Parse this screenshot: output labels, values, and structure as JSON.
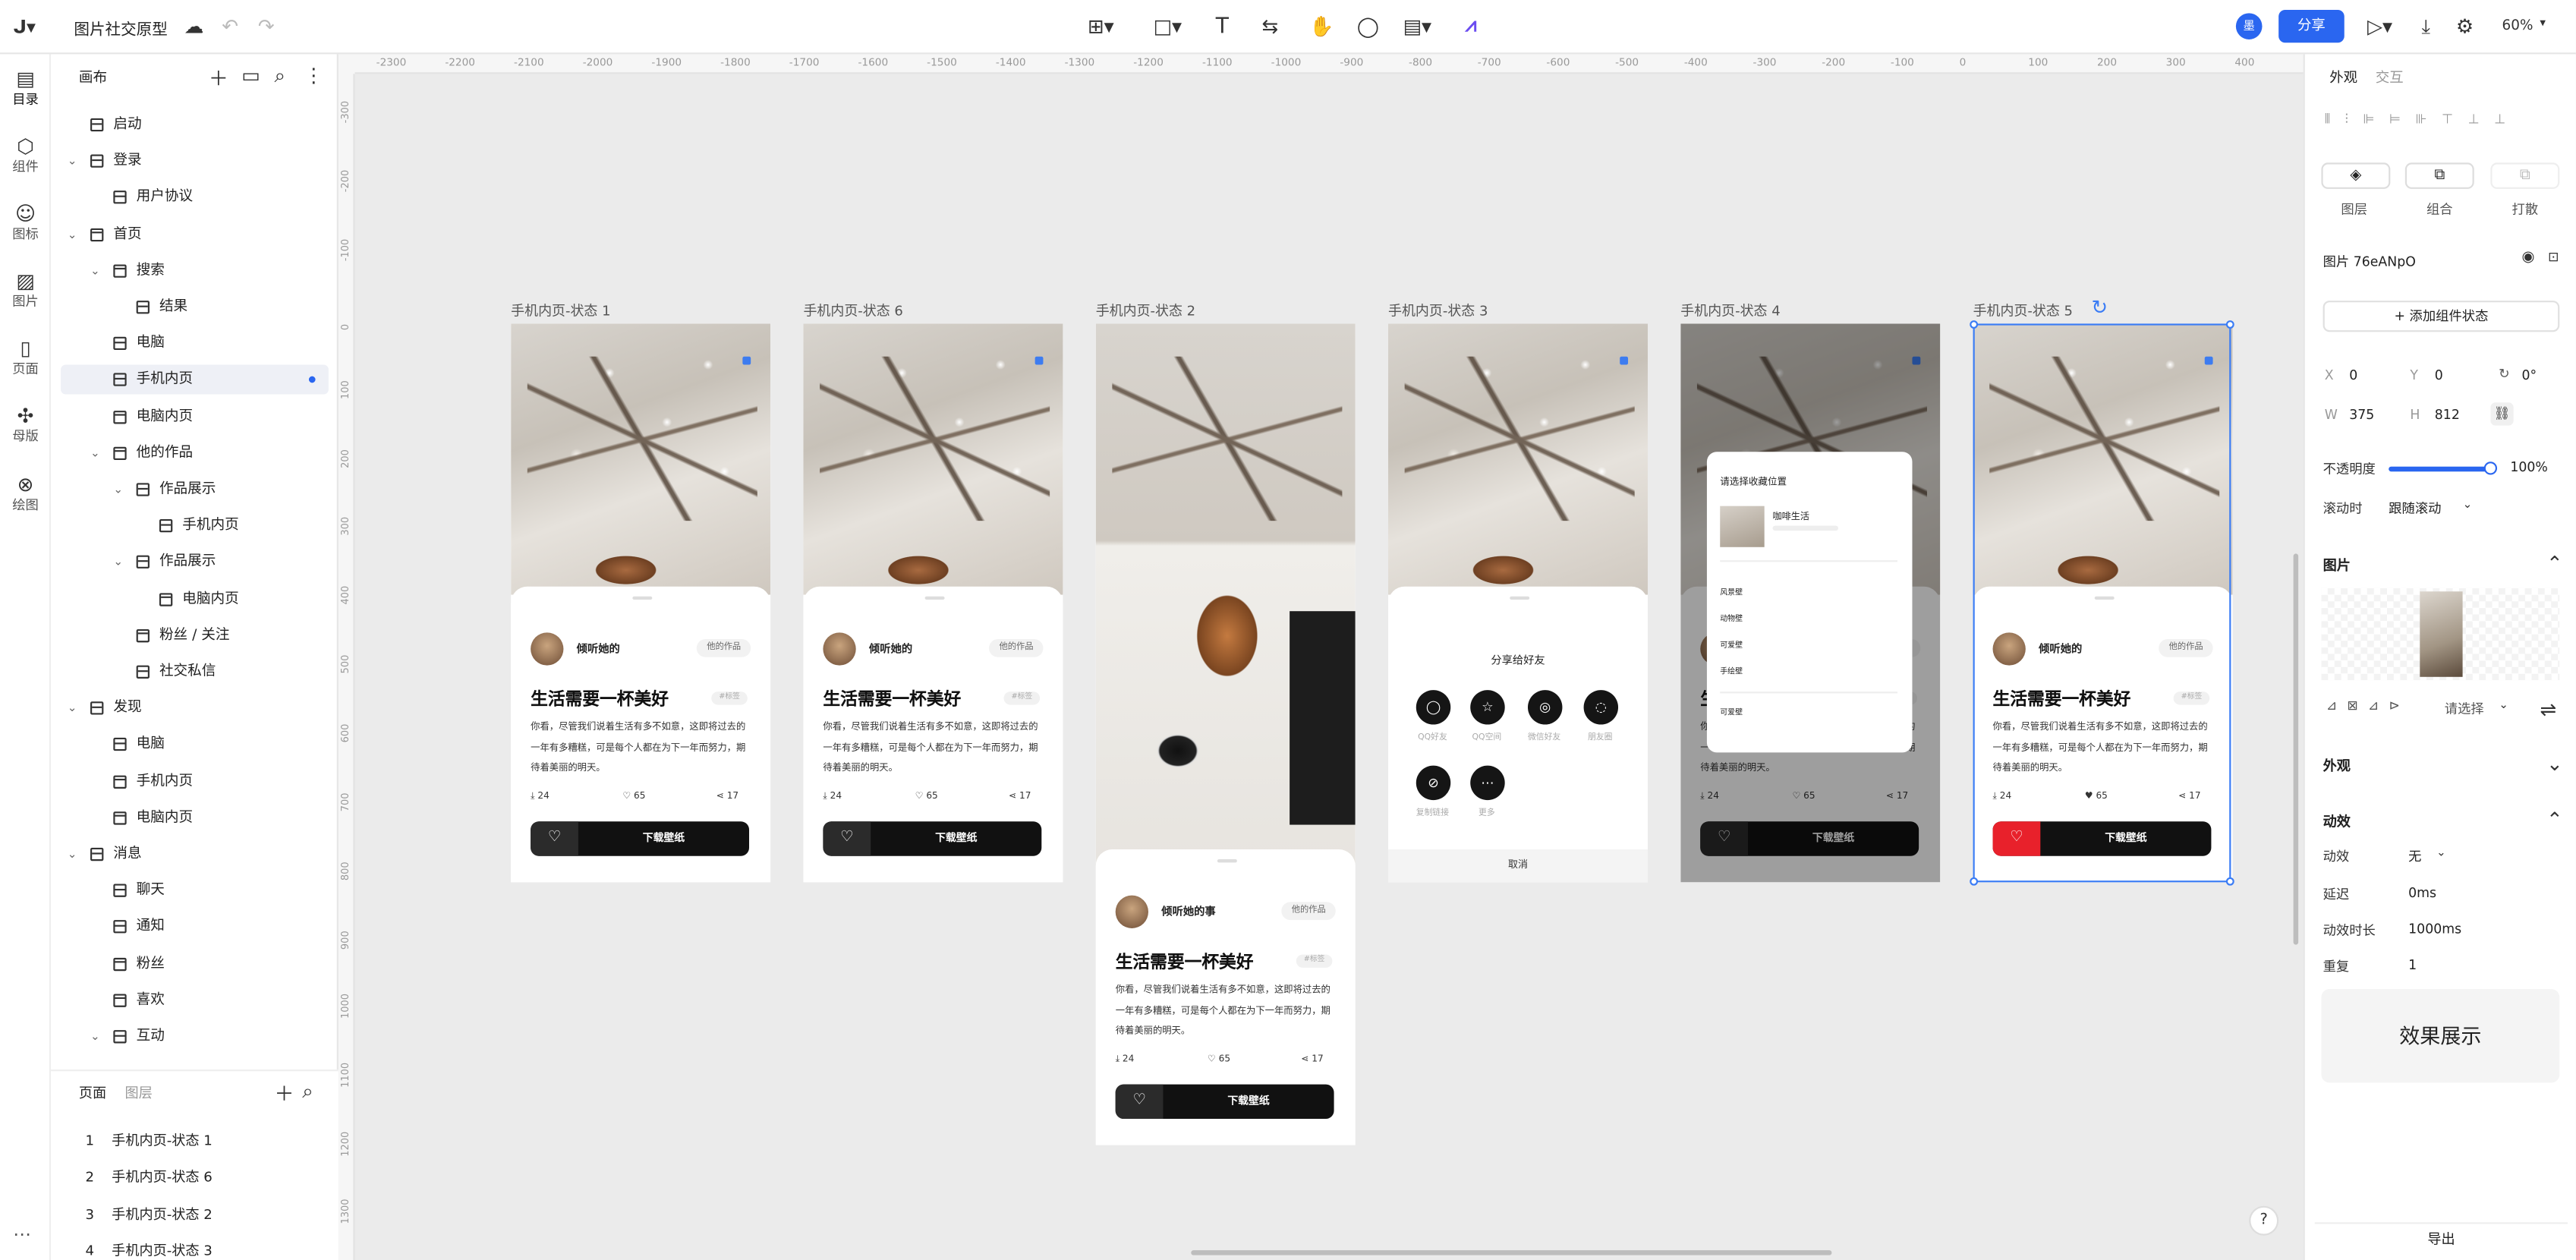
{
  "app": {
    "project_title": "图片社交原型",
    "zoom": "60%",
    "share_label": "分享",
    "avatar_char": "墨"
  },
  "rail": [
    {
      "icon": "layers-icon",
      "label": "目录"
    },
    {
      "icon": "component-icon",
      "label": "组件"
    },
    {
      "icon": "emoji-icon",
      "label": "图标"
    },
    {
      "icon": "image-icon",
      "label": "图片"
    },
    {
      "icon": "page-icon",
      "label": "页面"
    },
    {
      "icon": "master-icon",
      "label": "母版"
    },
    {
      "icon": "draw-icon",
      "label": "绘图"
    }
  ],
  "tree": {
    "header": "画布",
    "items": [
      {
        "label": "启动",
        "level": 0,
        "chev": false
      },
      {
        "label": "登录",
        "level": 0,
        "chev": true
      },
      {
        "label": "用户协议",
        "level": 1,
        "chev": false
      },
      {
        "label": "首页",
        "level": 0,
        "chev": true
      },
      {
        "label": "搜索",
        "level": 1,
        "chev": true
      },
      {
        "label": "结果",
        "level": 2,
        "chev": false
      },
      {
        "label": "电脑",
        "level": 1,
        "chev": false
      },
      {
        "label": "手机内页",
        "level": 1,
        "chev": false,
        "selected": true
      },
      {
        "label": "电脑内页",
        "level": 1,
        "chev": false
      },
      {
        "label": "他的作品",
        "level": 1,
        "chev": true
      },
      {
        "label": "作品展示",
        "level": 2,
        "chev": true
      },
      {
        "label": "手机内页",
        "level": 3,
        "chev": false
      },
      {
        "label": "作品展示",
        "level": 2,
        "chev": true
      },
      {
        "label": "电脑内页",
        "level": 3,
        "chev": false
      },
      {
        "label": "粉丝 / 关注",
        "level": 2,
        "chev": false
      },
      {
        "label": "社交私信",
        "level": 2,
        "chev": false
      },
      {
        "label": "发现",
        "level": 0,
        "chev": true
      },
      {
        "label": "电脑",
        "level": 1,
        "chev": false
      },
      {
        "label": "手机内页",
        "level": 1,
        "chev": false
      },
      {
        "label": "电脑内页",
        "level": 1,
        "chev": false
      },
      {
        "label": "消息",
        "level": 0,
        "chev": true
      },
      {
        "label": "聊天",
        "level": 1,
        "chev": false
      },
      {
        "label": "通知",
        "level": 1,
        "chev": false
      },
      {
        "label": "粉丝",
        "level": 1,
        "chev": false
      },
      {
        "label": "喜欢",
        "level": 1,
        "chev": false
      },
      {
        "label": "互动",
        "level": 1,
        "chev": true
      }
    ]
  },
  "pages_panel": {
    "tab_pages": "页面",
    "tab_layers": "图层",
    "items": [
      {
        "n": "1",
        "label": "手机内页-状态 1"
      },
      {
        "n": "2",
        "label": "手机内页-状态 6"
      },
      {
        "n": "3",
        "label": "手机内页-状态 2"
      },
      {
        "n": "4",
        "label": "手机内页-状态 3"
      }
    ]
  },
  "ruler_h": [
    "-2300",
    "-2200",
    "-2100",
    "-2000",
    "-1900",
    "-1800",
    "-1700",
    "-1600",
    "-1500",
    "-1400",
    "-1300",
    "-1200",
    "-1100",
    "-1000",
    "-900",
    "-800",
    "-700",
    "-600",
    "-500",
    "-400",
    "-300",
    "-200",
    "-100",
    "0",
    "100",
    "200",
    "300",
    "400"
  ],
  "ruler_v": [
    "-300",
    "-200",
    "-100",
    "0",
    "100",
    "200",
    "300",
    "400",
    "500",
    "600",
    "700",
    "800",
    "900",
    "1000",
    "1100",
    "1200",
    "1300"
  ],
  "frames": [
    {
      "label": "手机内页-状态 1",
      "variant": "normal"
    },
    {
      "label": "手机内页-状态 6",
      "variant": "normal"
    },
    {
      "label": "手机内页-状态 2",
      "variant": "tall"
    },
    {
      "label": "手机内页-状态 3",
      "variant": "share"
    },
    {
      "label": "手机内页-状态 4",
      "variant": "collect"
    },
    {
      "label": "手机内页-状态 5",
      "variant": "liked"
    }
  ],
  "card": {
    "user": "倾听她的",
    "user_full": "倾听她的事",
    "works_btn": "他的作品",
    "title": "生活需要一杯美好",
    "tag": "#标签",
    "desc": "你看，尽管我们说着生活有多不如意，这即将过去的一年有多糟糕，可是每个人都在为下一年而努力，期待着美丽的明天。",
    "downloads": "24",
    "likes": "65",
    "shares": "17",
    "download_label": "下载壁纸"
  },
  "share_sheet": {
    "title": "分享给好友",
    "items": [
      {
        "icon": "qq-icon",
        "label": "QQ好友"
      },
      {
        "icon": "star-icon",
        "label": "QQ空间"
      },
      {
        "icon": "wechat-icon",
        "label": "微信好友"
      },
      {
        "icon": "moments-icon",
        "label": "朋友圈"
      },
      {
        "icon": "link-icon",
        "label": "复制链接"
      },
      {
        "icon": "more-icon",
        "label": "更多"
      }
    ],
    "cancel": "取消"
  },
  "collect_sheet": {
    "title": "请选择收藏位置",
    "first": "咖啡生活",
    "items": [
      "风景壁",
      "动物壁",
      "可爱壁",
      "手绘壁"
    ],
    "last": "可爱壁"
  },
  "right": {
    "tab_appearance": "外观",
    "tab_interaction": "交互",
    "btn_layer": "图层",
    "btn_group": "组合",
    "btn_break": "打散",
    "element_name": "图片 76eANpO",
    "add_state": "+ 添加组件状态",
    "x_label": "X",
    "x": "0",
    "y_label": "Y",
    "y": "0",
    "rot": "0°",
    "w_label": "W",
    "w": "375",
    "h_label": "H",
    "h": "812",
    "opacity_label": "不透明度",
    "opacity": "100%",
    "opacity_value": 1.0,
    "scroll_label": "滚动时",
    "scroll_value": "跟随滚动",
    "image_section": "图片",
    "image_select": "请选择",
    "appearance_section": "外观",
    "anim_section": "动效",
    "anim_label": "动效",
    "anim_value": "无",
    "delay_label": "延迟",
    "delay": "0ms",
    "duration_label": "动效时长",
    "duration": "1000ms",
    "repeat_label": "重复",
    "repeat": "1",
    "preview": "效果展示",
    "export": "导出"
  },
  "colors": {
    "accent": "#2a66f0",
    "selection": "#3a7cf5",
    "liked": "#e8212b"
  }
}
